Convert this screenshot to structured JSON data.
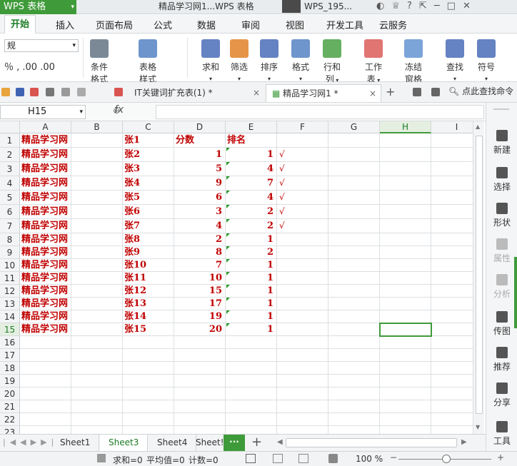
{
  "titlebar": {
    "app": "WPS 表格",
    "document_title": "精品学习网1...WPS 表格",
    "user": "WPS_195..."
  },
  "menu": {
    "tabs": [
      "开始",
      "插入",
      "页面布局",
      "公式",
      "数据",
      "审阅",
      "视图",
      "开发工具",
      "云服务"
    ],
    "active": "开始"
  },
  "ribbon": {
    "number_format_value": "规",
    "number_format_row": "％ ‚ .00 .00",
    "buttons": [
      {
        "label": "条件格式",
        "icon": "conditional-format-icon",
        "color": "#5a6b7d"
      },
      {
        "label": "表格样式",
        "icon": "table-style-icon",
        "color": "#4a7bbf"
      },
      {
        "label": "求和",
        "icon": "sigma-icon",
        "color": "#3f63b3"
      },
      {
        "label": "筛选",
        "icon": "filter-icon",
        "color": "#e07b1a"
      },
      {
        "label": "排序",
        "icon": "sort-icon",
        "color": "#3f63b3"
      },
      {
        "label": "格式",
        "icon": "format-icon",
        "color": "#4a7bbf"
      },
      {
        "label": "行和列",
        "icon": "row-col-icon",
        "color": "#3f9b3a"
      },
      {
        "label": "工作表",
        "icon": "worksheet-icon",
        "color": "#d9534f"
      },
      {
        "label": "冻结窗格",
        "icon": "freeze-pane-icon",
        "color": "#5a8fcf"
      },
      {
        "label": "查找",
        "icon": "find-icon",
        "color": "#3f63b3"
      },
      {
        "label": "符号",
        "icon": "omega-icon",
        "color": "#3f63b3"
      }
    ]
  },
  "doc_tabs": [
    {
      "label": "IT关键词扩充表(1) *",
      "close": "×",
      "active": false
    },
    {
      "label": "精品学习网1 *",
      "close": "×",
      "active": true
    }
  ],
  "search_label": "点此查找命令",
  "formula_bar": {
    "cell_ref": "H15",
    "fx_label": "fx",
    "value": ""
  },
  "columns": [
    "A",
    "B",
    "C",
    "D",
    "E",
    "F",
    "G",
    "H",
    "I"
  ],
  "rows": [
    "1",
    "2",
    "3",
    "4",
    "5",
    "6",
    "7",
    "8",
    "9",
    "10",
    "11",
    "12",
    "13",
    "14",
    "15",
    "16",
    "17",
    "18",
    "19",
    "20",
    "21",
    "22",
    "23"
  ],
  "table": {
    "header": {
      "A": "精品学习网",
      "C": "张1",
      "D": "分数",
      "E": "排名"
    },
    "data": [
      {
        "A": "精品学习网",
        "C": "张2",
        "D": "1",
        "E": "1",
        "F": "√"
      },
      {
        "A": "精品学习网",
        "C": "张3",
        "D": "5",
        "E": "4",
        "F": "√"
      },
      {
        "A": "精品学习网",
        "C": "张4",
        "D": "9",
        "E": "7",
        "F": "√"
      },
      {
        "A": "精品学习网",
        "C": "张5",
        "D": "6",
        "E": "4",
        "F": "√"
      },
      {
        "A": "精品学习网",
        "C": "张6",
        "D": "3",
        "E": "2",
        "F": "√"
      },
      {
        "A": "精品学习网",
        "C": "张7",
        "D": "4",
        "E": "2",
        "F": "√"
      },
      {
        "A": "精品学习网",
        "C": "张8",
        "D": "2",
        "E": "1",
        "F": ""
      },
      {
        "A": "精品学习网",
        "C": "张9",
        "D": "8",
        "E": "2",
        "F": ""
      },
      {
        "A": "精品学习网",
        "C": "张10",
        "D": "7",
        "E": "1",
        "F": ""
      },
      {
        "A": "精品学习网",
        "C": "张11",
        "D": "10",
        "E": "1",
        "F": ""
      },
      {
        "A": "精品学习网",
        "C": "张12",
        "D": "15",
        "E": "1",
        "F": ""
      },
      {
        "A": "精品学习网",
        "C": "张13",
        "D": "17",
        "E": "1",
        "F": ""
      },
      {
        "A": "精品学习网",
        "C": "张14",
        "D": "19",
        "E": "1",
        "F": ""
      },
      {
        "A": "精品学习网",
        "C": "张15",
        "D": "20",
        "E": "1",
        "F": ""
      }
    ]
  },
  "selected_cell": "H15",
  "sheets": [
    {
      "label": "Sheet1",
      "active": false
    },
    {
      "label": "Sheet3",
      "active": true
    },
    {
      "label": "Sheet4",
      "active": false
    },
    {
      "label": "Sheet!",
      "active": false
    }
  ],
  "sheet_more": "···",
  "add_sheet": "+",
  "status": {
    "sum": "求和=0",
    "avg": "平均值=0",
    "count": "计数=0",
    "zoom": "100 %"
  },
  "right_pane": [
    "新建",
    "选择",
    "形状",
    "属性",
    "分析",
    "传图",
    "推荐",
    "分享",
    "工具"
  ],
  "colors": {
    "accent": "#3f9b3a",
    "data_text": "#c00000"
  }
}
